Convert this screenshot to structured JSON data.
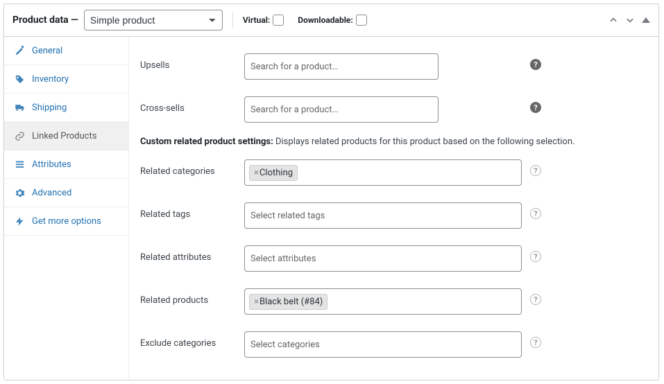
{
  "header": {
    "title_prefix": "Product data —",
    "product_type": "Simple product",
    "virtual_label": "Virtual:",
    "downloadable_label": "Downloadable:"
  },
  "sidebar": {
    "items": [
      {
        "label": "General",
        "active": false
      },
      {
        "label": "Inventory",
        "active": false
      },
      {
        "label": "Shipping",
        "active": false
      },
      {
        "label": "Linked Products",
        "active": true
      },
      {
        "label": "Attributes",
        "active": false
      },
      {
        "label": "Advanced",
        "active": false
      },
      {
        "label": "Get more options",
        "active": false
      }
    ]
  },
  "content": {
    "upsells_label": "Upsells",
    "crosssells_label": "Cross-sells",
    "search_placeholder": "Search for a product…",
    "custom_heading_bold": "Custom related product settings:",
    "custom_heading_rest": " Displays related products for this product based on the following selection.",
    "related_categories_label": "Related categories",
    "related_categories_chips": [
      "Clothing"
    ],
    "related_tags_label": "Related tags",
    "related_tags_placeholder": "Select related tags",
    "related_attributes_label": "Related attributes",
    "related_attributes_placeholder": "Select attributes",
    "related_products_label": "Related products",
    "related_products_chips": [
      "Black belt (#84)"
    ],
    "exclude_categories_label": "Exclude categories",
    "exclude_categories_placeholder": "Select categories"
  }
}
